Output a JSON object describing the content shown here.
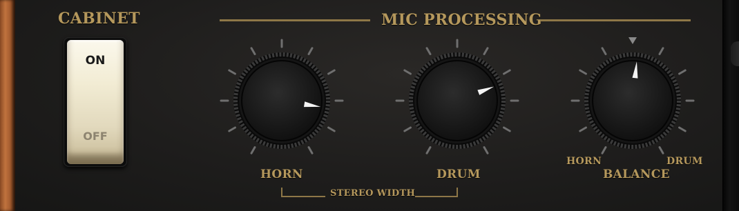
{
  "cabinet": {
    "title": "CABINET",
    "switch": {
      "on_label": "ON",
      "off_label": "OFF",
      "state": "on"
    }
  },
  "mic_processing": {
    "title": "MIC PROCESSING",
    "horn": {
      "label": "HORN",
      "value_fraction": 0.83
    },
    "drum": {
      "label": "DRUM",
      "value_fraction": 0.73
    },
    "stereo_width_label": "STEREO WIDTH",
    "balance": {
      "label": "BALANCE",
      "min_label": "HORN",
      "max_label": "DRUM",
      "value_fraction": 0.52,
      "center_marker": "triangle-down-icon"
    }
  },
  "colors": {
    "label_gold": "#b5985c",
    "rule_gold": "#8e7747",
    "panel_bg": "#1e1d1c",
    "switch_cream": "#f2ecd4",
    "tick_gray": "#6f6f6f",
    "pointer_white": "#f4f4f4"
  }
}
